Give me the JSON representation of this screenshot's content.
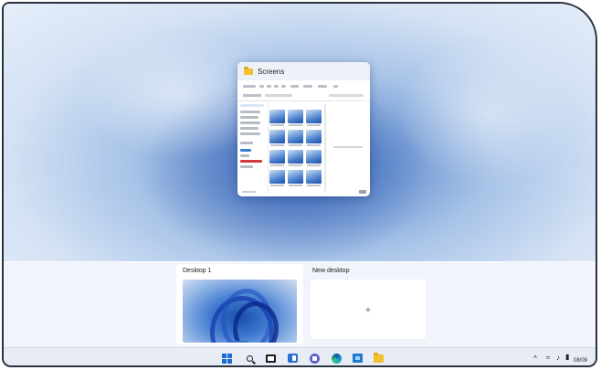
{
  "window": {
    "title": "Screens"
  },
  "task_view": {
    "desktops": [
      {
        "label": "Desktop 1"
      }
    ],
    "new_desktop_label": "New desktop",
    "new_desktop_glyph": "+"
  },
  "taskbar": {
    "icons": [
      "start-icon",
      "search-icon",
      "task-view-icon",
      "widgets-icon",
      "teams-chat-icon",
      "edge-icon",
      "store-icon",
      "file-explorer-icon"
    ],
    "tray": {
      "chevron": "^",
      "clock": "08/09"
    }
  },
  "colors": {
    "accent": "#1a6ed8",
    "taskbar": "#e8edf5",
    "strip": "#f0f4fa"
  }
}
